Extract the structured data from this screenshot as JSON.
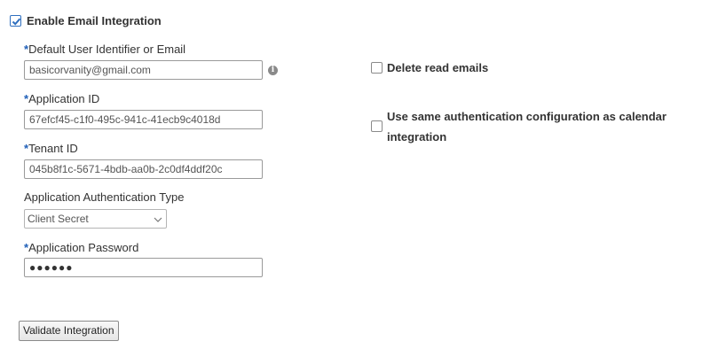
{
  "enable": {
    "label": "Enable Email Integration",
    "checked": true
  },
  "fields": {
    "user_identifier": {
      "required_mark": "*",
      "label": "Default User Identifier or Email",
      "value": "basicorvanity@gmail.com",
      "info_icon": "info-icon"
    },
    "application_id": {
      "required_mark": "*",
      "label": "Application ID",
      "value": "67efcf45-c1f0-495c-941c-41ecb9c4018d"
    },
    "tenant_id": {
      "required_mark": "*",
      "label": "Tenant ID",
      "value": "045b8f1c-5671-4bdb-aa0b-2c0df4ddf20c"
    },
    "auth_type": {
      "label": "Application Authentication Type",
      "value": "Client Secret",
      "icon": "chevron-down-icon"
    },
    "password": {
      "required_mark": "*",
      "label": "Application Password",
      "value": "●●●●●●"
    }
  },
  "options": {
    "delete_read": {
      "label": "Delete read emails",
      "checked": false
    },
    "same_auth": {
      "label_line1": "Use same authentication configuration as calendar",
      "label_line2": "integration",
      "checked": false
    }
  },
  "buttons": {
    "validate": "Validate Integration"
  },
  "colors": {
    "accent": "#1f5fb8",
    "checkbox_check": "#2f6fbf"
  }
}
